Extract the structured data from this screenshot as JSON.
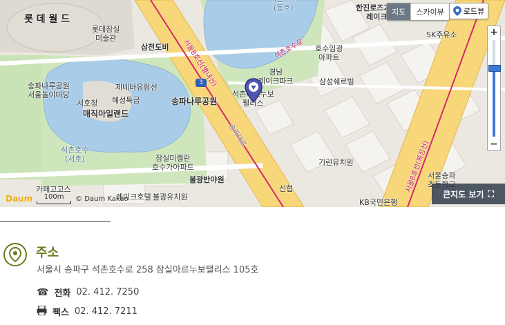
{
  "map": {
    "type_tabs": [
      "지도",
      "스카이뷰"
    ],
    "active_tab": "지도",
    "roadview_label": "로드뷰",
    "zoom": {
      "in_label": "+",
      "out_label": "−",
      "level_fraction": 0.72
    },
    "big_map_label": "큰지도 보기",
    "copyright": "© Daum Kakao",
    "logo": "Daum",
    "scale": "100m",
    "labels": {
      "lotte_world": "롯 데 월 드",
      "lotte_art": "롯데잠실\n미술관",
      "samjeon": "삼전도비",
      "songpa_park_left": "송파나루공원\n서울놀이마당",
      "jeju_balloon": "제네바유람선",
      "seohojeong": "서호정",
      "hyesungteukgeup": "혜성특급",
      "magic_island": "매직아일랜드",
      "seochon_lake": "석촌호수\n(서호)",
      "songpa_park": "송파나루공원",
      "lake_east": "석촌호수\n(동호)",
      "hanjin_rose": "한진로즈가든\n레이크",
      "sk_oil": "SK주유소",
      "hosu_apt": "호수임광\n아파트",
      "gyeongnam": "경남\n레이크파크",
      "samsung_swill": "삼성쉐르빌",
      "target_building": "석촌아르누보\n팰리스",
      "jamsil_michelan": "잠실미켈란\n호수가아파트",
      "bulgwang": "불광반야원",
      "kirin": "기린유치원",
      "sinhan": "신협",
      "kb": "KB국민은행",
      "cafe_high": "카페고고스",
      "lake_hotel": "레이크호텔",
      "bulgwang_kinder": "불광유치원",
      "seoul_songpa": "서울송파\n초등학교",
      "road1": "석촌호수로",
      "road2": "송파대로",
      "road3": "서울8호선(별내선)",
      "road4": "서울8호선(복정선)",
      "route_no": "3"
    }
  },
  "info": {
    "title": "주소",
    "address": "서울시 송파구 석촌호수로 258 잠실아르누보팰리스 105호",
    "phone_label": "전화",
    "phone": "02. 412. 7250",
    "fax_label": "팩스",
    "fax": "02. 412. 7211"
  },
  "colors": {
    "accent": "#6c7a1b",
    "water": "#9ec6e6",
    "park": "#c7e2b4",
    "road": "#f7d36b",
    "rail": "#d6286b"
  }
}
